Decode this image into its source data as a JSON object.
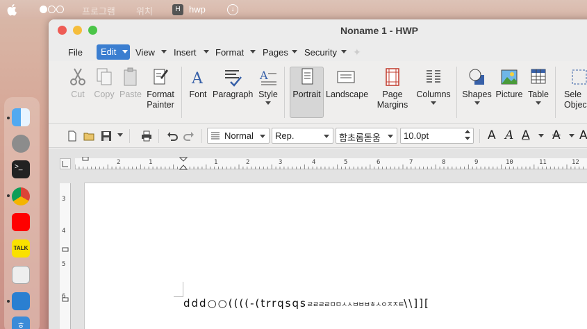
{
  "topbar": {
    "menu1": "프로그램",
    "menu2": "위치",
    "app_name": "hwp"
  },
  "window": {
    "title": "Noname 1 - HWP"
  },
  "menubar": {
    "file": "File",
    "edit": "Edit",
    "view": "View",
    "insert": "Insert",
    "format": "Format",
    "pages": "Pages",
    "security": "Security"
  },
  "ribbon": {
    "cut": "Cut",
    "copy": "Copy",
    "paste": "Paste",
    "format_painter_1": "Format",
    "format_painter_2": "Painter",
    "font": "Font",
    "paragraph": "Paragraph",
    "style": "Style",
    "portrait": "Portrait",
    "landscape": "Landscape",
    "page_margins_1": "Page",
    "page_margins_2": "Margins",
    "columns": "Columns",
    "shapes": "Shapes",
    "picture": "Picture",
    "table": "Table",
    "select_objects_1": "Sele",
    "select_objects_2": "Objec"
  },
  "toolbar": {
    "style_value": "Normal",
    "font_group_value": "Rep.",
    "font_name_value": "함초롬돋움",
    "font_size_value": "10.0pt"
  },
  "ruler": {
    "h_numbers": [
      "2",
      "1",
      "1",
      "2",
      "3",
      "4",
      "5",
      "6",
      "7",
      "8",
      "9",
      "10",
      "11",
      "12"
    ],
    "v_numbers": [
      "3",
      "4",
      "5",
      "6"
    ]
  },
  "document": {
    "text_main": "ddd○○((((-(trrqsqs",
    "text_small": "ㄹㄹㄹㄹㅁㅁㅅㅅㅂㅂㅂㅎㅅㅇㅈㅈㅌ",
    "text_end": "\\\\]]["
  }
}
